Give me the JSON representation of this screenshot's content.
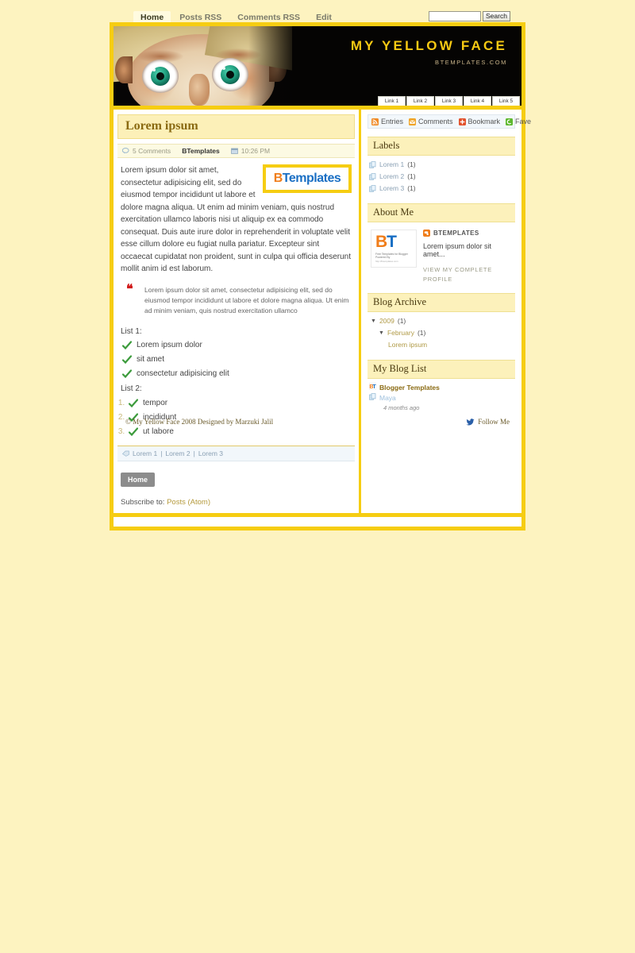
{
  "topnav": {
    "items": [
      {
        "label": "Home",
        "active": true
      },
      {
        "label": "Posts RSS",
        "active": false
      },
      {
        "label": "Comments RSS",
        "active": false
      },
      {
        "label": "Edit",
        "active": false
      }
    ]
  },
  "search": {
    "value": "",
    "placeholder": "",
    "button_label": "Search"
  },
  "header": {
    "title": "MY YELLOW FACE",
    "subtitle": "BTEMPLATES.COM",
    "nav_links": [
      "Link 1",
      "Link 2",
      "Link 3",
      "Link 4",
      "Link 5"
    ]
  },
  "post": {
    "title": "Lorem ipsum",
    "comments": "5 Comments",
    "author": "BTemplates",
    "time": "10:26 PM",
    "logo": {
      "b": "B",
      "rest": "Templates"
    },
    "paragraph1": "Lorem ipsum dolor sit amet, consectetur adipisicing elit, sed do eiusmod tempor incididunt ut labore et dolore magna aliqua. Ut enim ad minim veniam, quis nostrud exercitation ullamco laboris nisi ut aliquip ex ea commodo consequat. Duis aute irure dolor in reprehenderit in voluptate velit esse cillum dolore eu fugiat nulla pariatur. Excepteur sint occaecat cupidatat non proident, sunt in culpa qui officia deserunt mollit anim id est laborum.",
    "quote": "Lorem ipsum dolor sit amet, consectetur adipisicing elit, sed do eiusmod tempor incididunt ut labore et dolore magna aliqua. Ut enim ad minim veniam, quis nostrud exercitation ullamco",
    "list1_label": "List 1:",
    "list1": [
      "Lorem ipsum dolor",
      "sit amet",
      "consectetur adipisicing elit"
    ],
    "list2_label": "List 2:",
    "list2": [
      "tempor",
      "incididunt",
      "ut labore"
    ],
    "labels": [
      "Lorem 1",
      "Lorem 2",
      "Lorem 3"
    ],
    "label_sep": "|",
    "home_button": "Home",
    "subscribe_text": "Subscribe to:",
    "subscribe_link": "Posts (Atom)"
  },
  "sidebar": {
    "feedbar": [
      {
        "label": "Entries",
        "icon": "rss-icon"
      },
      {
        "label": "Comments",
        "icon": "mail-icon"
      },
      {
        "label": "Bookmark",
        "icon": "plus-icon"
      },
      {
        "label": "Fave",
        "icon": "fave-icon"
      }
    ],
    "labels_head": "Labels",
    "labels": [
      {
        "name": "Lorem 1",
        "count": "(1)"
      },
      {
        "name": "Lorem 2",
        "count": "(1)"
      },
      {
        "name": "Lorem 3",
        "count": "(1)"
      }
    ],
    "about_head": "About Me",
    "about": {
      "name": "BTEMPLATES",
      "desc": "Lorem ipsum dolor sit amet...",
      "profile_link": "VIEW MY COMPLETE PROFILE",
      "avatar_b": "B",
      "avatar_t": "T",
      "avatar_line1": "Free Templates for Blogger Powered By",
      "avatar_line2": "http://btemplates.com"
    },
    "archive_head": "Blog Archive",
    "archive": {
      "year": "2009",
      "year_count": "(1)",
      "month": "February",
      "month_count": "(1)",
      "post": "Lorem ipsum"
    },
    "bloglist_head": "My Blog List",
    "bloglist": [
      {
        "title": "Blogger Templates",
        "sub": "Maya",
        "time": "4 months ago"
      }
    ]
  },
  "footer": {
    "copyright": "© My Yellow Face 2008 Designed by Marzuki Jalil",
    "follow": "Follow Me"
  },
  "colors": {
    "frame_yellow": "#f6cd12",
    "page_bg": "#fdf3c0",
    "title_yellow": "#f6c913",
    "accent_brown": "#8a6a12"
  }
}
